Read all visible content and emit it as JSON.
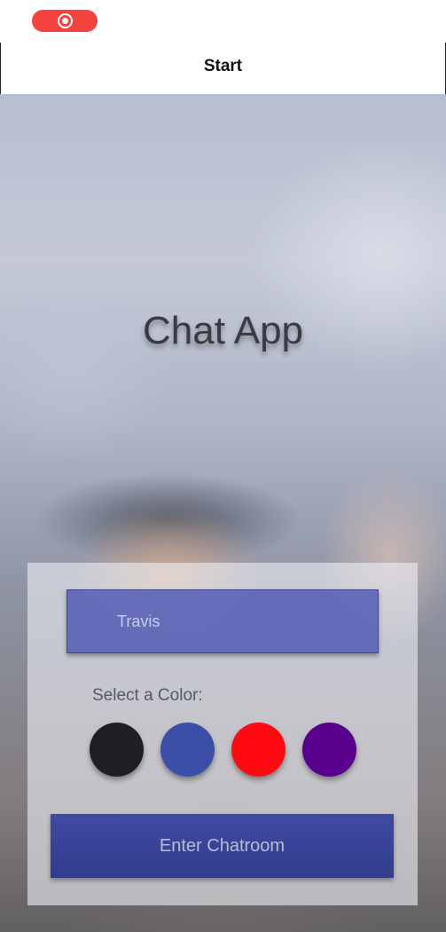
{
  "status_bar": {
    "record_icon": "record-icon",
    "record_color": "#f4423f"
  },
  "nav": {
    "title": "Start"
  },
  "main": {
    "app_title": "Chat App"
  },
  "form": {
    "name_input": {
      "value": "Travis",
      "placeholder": "Travis"
    },
    "color_label": "Select a Color:",
    "colors": [
      "#1f1e22",
      "#3b4ea8",
      "#ff0a10",
      "#5a008f"
    ],
    "enter_button": "Enter Chatroom",
    "button_color": "#3a449a",
    "input_color": "#525cb4"
  }
}
